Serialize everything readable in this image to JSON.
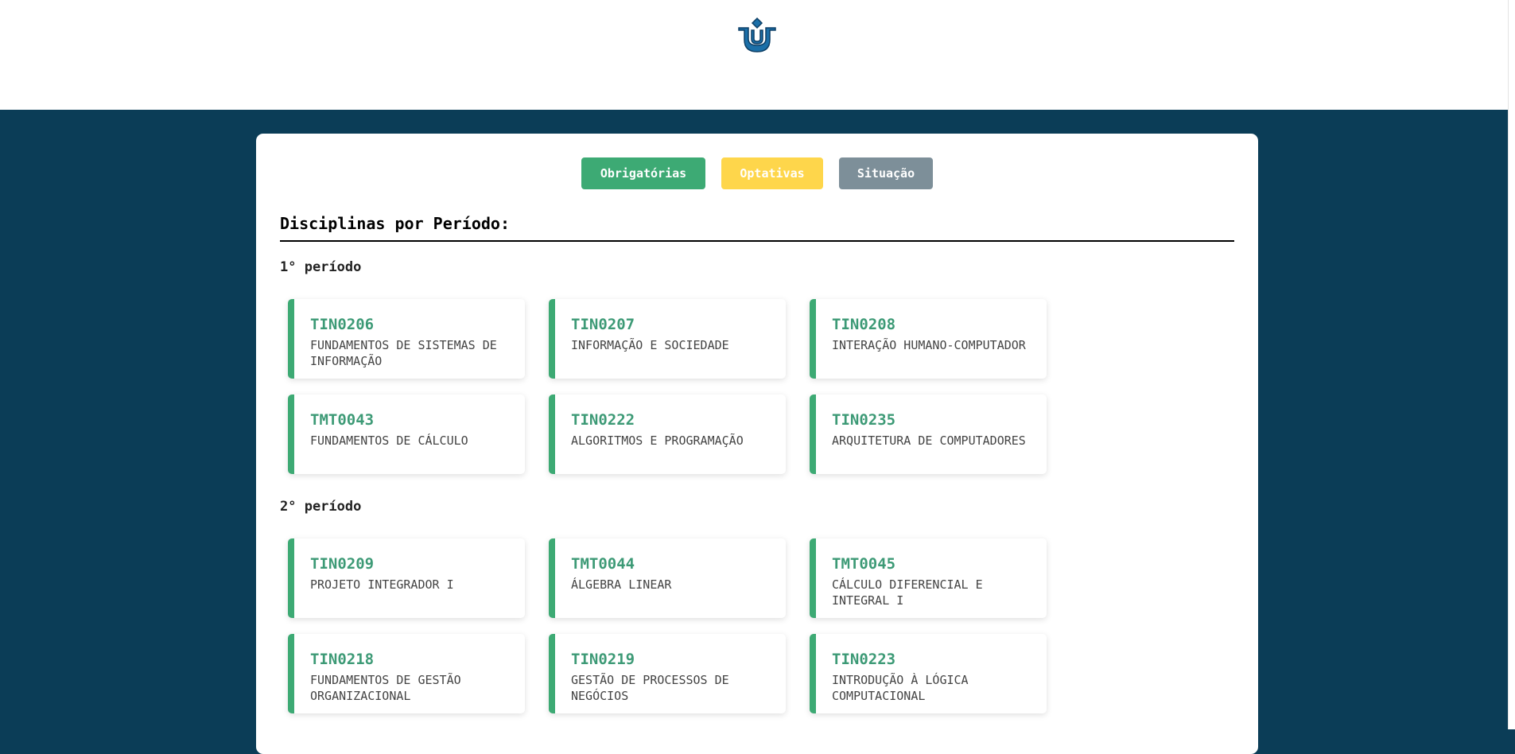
{
  "header": {
    "logo": {
      "icon": "university-logo-icon",
      "color": "#1b6fa8"
    }
  },
  "colors": {
    "background": "#0b3d57",
    "accent_green": "#3daa74",
    "code_green": "#3d9a76",
    "yellow": "#fed64b",
    "gray": "#7d8f99"
  },
  "filters": {
    "mandatory_label": "Obrigatórias",
    "optional_label": "Optativas",
    "status_label": "Situação"
  },
  "content": {
    "heading": "Disciplinas por Período:",
    "periods": [
      {
        "title": "1° período",
        "courses": [
          {
            "code": "TIN0206",
            "name": "FUNDAMENTOS DE SISTEMAS DE INFORMAÇÃO"
          },
          {
            "code": "TIN0207",
            "name": "INFORMAÇÃO E SOCIEDADE"
          },
          {
            "code": "TIN0208",
            "name": "INTERAÇÃO HUMANO-COMPUTADOR"
          },
          {
            "code": "TMT0043",
            "name": "FUNDAMENTOS DE CÁLCULO"
          },
          {
            "code": "TIN0222",
            "name": "ALGORITMOS E PROGRAMAÇÃO"
          },
          {
            "code": "TIN0235",
            "name": "ARQUITETURA DE COMPUTADORES"
          }
        ]
      },
      {
        "title": "2° período",
        "courses": [
          {
            "code": "TIN0209",
            "name": "PROJETO INTEGRADOR I"
          },
          {
            "code": "TMT0044",
            "name": "ÁLGEBRA LINEAR"
          },
          {
            "code": "TMT0045",
            "name": "CÁLCULO DIFERENCIAL E INTEGRAL I"
          },
          {
            "code": "TIN0218",
            "name": "FUNDAMENTOS DE GESTÃO ORGANIZACIONAL"
          },
          {
            "code": "TIN0219",
            "name": "GESTÃO DE PROCESSOS DE NEGÓCIOS"
          },
          {
            "code": "TIN0223",
            "name": "INTRODUÇÃO À LÓGICA COMPUTACIONAL"
          }
        ]
      }
    ]
  }
}
